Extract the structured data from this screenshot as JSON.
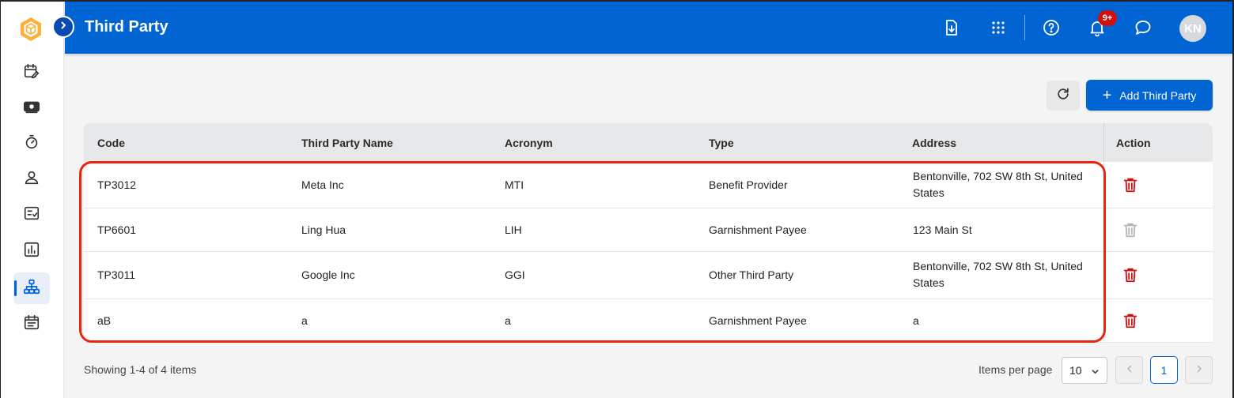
{
  "app": {
    "title": "Third Party",
    "brand_color": "#0064d2",
    "danger_color": "#d10f0f"
  },
  "sidebar": {
    "logo_icon": "cube-logo-icon",
    "toggle_icon": "chevron-right-icon",
    "items": [
      {
        "icon": "calendar-edit-icon",
        "active": false
      },
      {
        "icon": "money-icon",
        "active": false
      },
      {
        "icon": "timer-icon",
        "active": false
      },
      {
        "icon": "person-icon",
        "active": false
      },
      {
        "icon": "checklist-icon",
        "active": false
      },
      {
        "icon": "bar-chart-icon",
        "active": false
      },
      {
        "icon": "org-chart-icon",
        "active": true
      },
      {
        "icon": "calendar-list-icon",
        "active": false
      }
    ]
  },
  "header": {
    "icons": [
      "download-file-icon",
      "apps-grid-icon",
      "help-icon",
      "bell-icon",
      "chat-icon"
    ],
    "notification_badge": "9+",
    "avatar_initials": "KN"
  },
  "toolbar": {
    "refresh_icon": "refresh-icon",
    "add_label": "Add Third Party"
  },
  "table": {
    "columns": [
      "Code",
      "Third Party Name",
      "Acronym",
      "Type",
      "Address",
      "Action"
    ],
    "rows": [
      {
        "code": "TP3012",
        "name": "Meta Inc",
        "acronym": "MTI",
        "type": "Benefit Provider",
        "address": "Bentonville, 702 SW 8th St, United States",
        "delete_enabled": true
      },
      {
        "code": "TP6601",
        "name": "Ling Hua",
        "acronym": "LIH",
        "type": "Garnishment Payee",
        "address": "123 Main St",
        "delete_enabled": false
      },
      {
        "code": "TP3011",
        "name": "Google Inc",
        "acronym": "GGI",
        "type": "Other Third Party",
        "address": "Bentonville, 702 SW 8th St, United States",
        "delete_enabled": true
      },
      {
        "code": "aB",
        "name": "a",
        "acronym": "a",
        "type": "Garnishment Payee",
        "address": "a",
        "delete_enabled": true
      }
    ]
  },
  "footer": {
    "showing": "Showing 1-4 of 4 items",
    "items_per_page_label": "Items per page",
    "items_per_page_value": "10",
    "current_page": "1"
  }
}
